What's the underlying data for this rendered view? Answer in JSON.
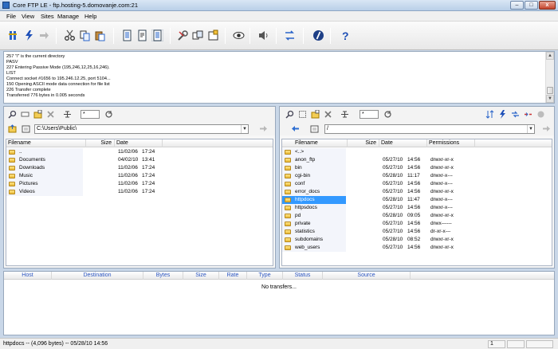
{
  "window": {
    "title": "Core FTP LE - ftp.hosting-5.domovanje.com:21",
    "controls": [
      "–",
      "□",
      "x"
    ]
  },
  "menu": [
    "File",
    "View",
    "Sites",
    "Manage",
    "Help"
  ],
  "toolbar": [
    "connect-icon",
    "quick-connect-icon",
    "disconnect-icon",
    "cut-icon",
    "copy-icon",
    "paste-icon",
    "view-file-icon",
    "edit-file-icon",
    "properties-icon",
    "settings-icon",
    "site-manager-icon",
    "transfer-icon",
    "view-icon",
    "sound-icon",
    "sync-icon",
    "edit-icon",
    "help-icon"
  ],
  "log": [
    "257 \"/\" is the current directory",
    "PASV",
    "227 Entering Passive Mode (195,246,12,25,16,246).",
    "LIST",
    "Connect socket #1656 to 195.246.12.25, port 5104...",
    "150 Opening ASCII mode data connection for file list",
    "226 Transfer complete",
    "Transferred 776 bytes in 0.005 seconds"
  ],
  "local": {
    "filter": "*",
    "path": "C:\\Users\\Public\\",
    "columns": [
      "Filename",
      "Size",
      "Date"
    ],
    "rows": [
      {
        "name": "..",
        "size": "",
        "date": "11/02/06",
        "time": "17:24"
      },
      {
        "name": "Documents",
        "size": "",
        "date": "04/02/10",
        "time": "13:41"
      },
      {
        "name": "Downloads",
        "size": "",
        "date": "11/02/06",
        "time": "17:24"
      },
      {
        "name": "Music",
        "size": "",
        "date": "11/02/06",
        "time": "17:24"
      },
      {
        "name": "Pictures",
        "size": "",
        "date": "11/02/06",
        "time": "17:24"
      },
      {
        "name": "Videos",
        "size": "",
        "date": "11/02/06",
        "time": "17:24"
      }
    ]
  },
  "remote": {
    "filter": "*",
    "path": "/",
    "columns": [
      "Filename",
      "Size",
      "Date",
      "Permissions"
    ],
    "rows": [
      {
        "name": "<..>",
        "date": "",
        "time": "",
        "perm": ""
      },
      {
        "name": "anon_ftp",
        "date": "05/27/10",
        "time": "14:56",
        "perm": "drwxr-xr-x"
      },
      {
        "name": "bin",
        "date": "05/27/10",
        "time": "14:56",
        "perm": "drwxr-xr-x"
      },
      {
        "name": "cgi-bin",
        "date": "05/28/10",
        "time": "11:17",
        "perm": "drwxr-x---"
      },
      {
        "name": "conf",
        "date": "05/27/10",
        "time": "14:56",
        "perm": "drwxr-x---"
      },
      {
        "name": "error_docs",
        "date": "05/27/10",
        "time": "14:56",
        "perm": "drwxr-xr-x"
      },
      {
        "name": "httpdocs",
        "date": "05/28/10",
        "time": "11:47",
        "perm": "drwxr-x---"
      },
      {
        "name": "httpsdocs",
        "date": "05/27/10",
        "time": "14:56",
        "perm": "drwxr-x---"
      },
      {
        "name": "pd",
        "date": "05/28/10",
        "time": "09:05",
        "perm": "drwxr-xr-x"
      },
      {
        "name": "private",
        "date": "05/27/10",
        "time": "14:56",
        "perm": "drwx------"
      },
      {
        "name": "statistics",
        "date": "05/27/10",
        "time": "14:56",
        "perm": "dr-xr-x---"
      },
      {
        "name": "subdomains",
        "date": "05/28/10",
        "time": "08:52",
        "perm": "drwxr-xr-x"
      },
      {
        "name": "web_users",
        "date": "05/27/10",
        "time": "14:56",
        "perm": "drwxr-xr-x"
      }
    ],
    "selected": "httpdocs"
  },
  "queue": {
    "columns": [
      "Host",
      "Destination",
      "Bytes",
      "Size",
      "Rate",
      "Type",
      "Status",
      "Source"
    ],
    "empty_text": "No transfers..."
  },
  "status": {
    "text": "httpdocs -- (4,096 bytes) -- 05/28/10 14:56",
    "page": "1"
  }
}
